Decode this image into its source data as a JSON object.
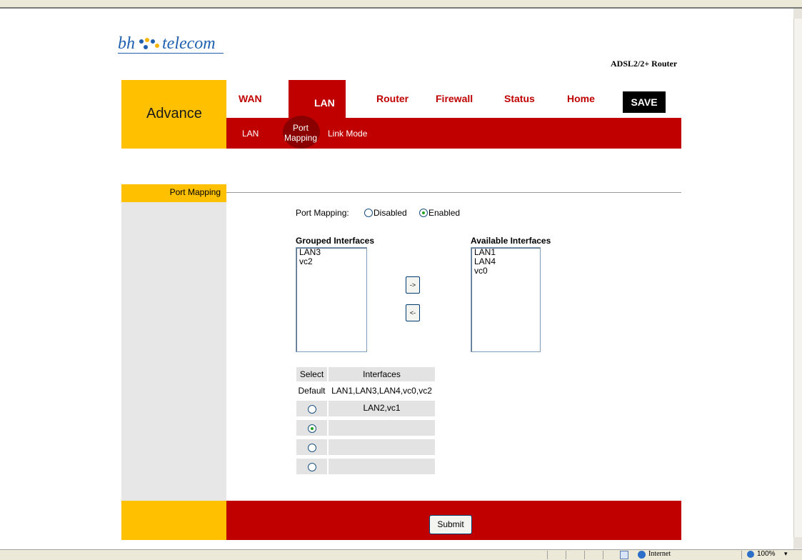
{
  "header": {
    "logo_left": "bh",
    "logo_right": "telecom",
    "product": "ADSL2/2+ Router"
  },
  "nav": {
    "section": "Advance",
    "tabs": [
      "WAN",
      "LAN",
      "Router",
      "Firewall",
      "Status",
      "Home"
    ],
    "active_tab": "LAN",
    "save_label": "SAVE",
    "subtabs": [
      "LAN",
      "Port Mapping",
      "Link Mode"
    ],
    "active_subtab": "Port Mapping"
  },
  "section": {
    "title": "Port Mapping"
  },
  "port_mapping": {
    "label": "Port Mapping:",
    "options": [
      "Disabled",
      "Enabled"
    ],
    "selected": "Enabled"
  },
  "grouped": {
    "title": "Grouped Interfaces",
    "items": [
      "LAN3",
      "vc2"
    ]
  },
  "available": {
    "title": "Available Interfaces",
    "items": [
      "LAN1",
      "LAN4",
      "vc0"
    ]
  },
  "buttons": {
    "move_right": "->",
    "move_left": "<-",
    "submit": "Submit"
  },
  "group_table": {
    "headers": [
      "Select",
      "Interfaces"
    ],
    "default_label": "Default",
    "default_interfaces": "LAN1,LAN3,LAN4,vc0,vc2",
    "rows": [
      {
        "interfaces": "LAN2,vc1",
        "selected": false
      },
      {
        "interfaces": "",
        "selected": true
      },
      {
        "interfaces": "",
        "selected": false
      },
      {
        "interfaces": "",
        "selected": false
      }
    ]
  },
  "statusbar": {
    "zone": "Internet",
    "zoom": "100%"
  },
  "colors": {
    "accent_red": "#c00000",
    "accent_yellow": "#ffc000",
    "logo_blue": "#1f5fb0"
  }
}
